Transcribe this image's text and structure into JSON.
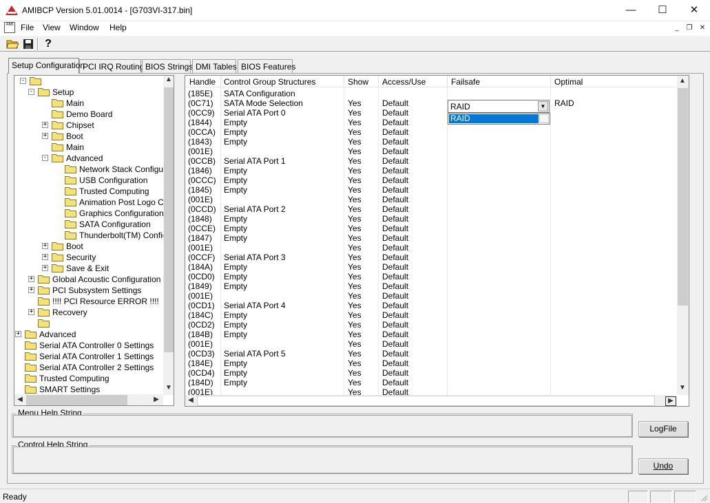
{
  "window": {
    "title": "AMIBCP Version 5.01.0014 - [G703VI-317.bin]",
    "minimize_glyph": "—",
    "maximize_glyph": "☐",
    "close_glyph": "✕"
  },
  "menu": {
    "mdi_icon_text": "AMI",
    "items": [
      "File",
      "View",
      "Window",
      "Help"
    ],
    "mdi_minimize": "_",
    "mdi_restore": "❐",
    "mdi_close": "✕"
  },
  "toolbar": {
    "buttons": [
      "open-folder-icon",
      "save-icon",
      "help-icon"
    ],
    "help_glyph": "?"
  },
  "tabs": [
    "Setup Configuration",
    "PCI IRQ Routing",
    "BIOS Strings",
    "DMI Tables",
    "BIOS Features"
  ],
  "tree": {
    "items": [
      {
        "label": "",
        "expander": "-"
      },
      {
        "label": "Setup",
        "expander": "-"
      },
      {
        "label": "Main",
        "expander": ""
      },
      {
        "label": "Demo Board",
        "expander": ""
      },
      {
        "label": "Chipset",
        "expander": "+"
      },
      {
        "label": "Boot",
        "expander": "+"
      },
      {
        "label": "Main",
        "expander": ""
      },
      {
        "label": "Advanced",
        "expander": "-"
      },
      {
        "label": "Network Stack Configura",
        "expander": ""
      },
      {
        "label": "USB Configuration",
        "expander": ""
      },
      {
        "label": "Trusted Computing",
        "expander": ""
      },
      {
        "label": "Animation Post Logo Con",
        "expander": ""
      },
      {
        "label": "Graphics Configuration",
        "expander": ""
      },
      {
        "label": "SATA Configuration",
        "expander": ""
      },
      {
        "label": "Thunderbolt(TM) Configu",
        "expander": ""
      },
      {
        "label": "Boot",
        "expander": "+"
      },
      {
        "label": "Security",
        "expander": "+"
      },
      {
        "label": "Save & Exit",
        "expander": "+"
      },
      {
        "label": "Global Acoustic Configuration",
        "expander": "+"
      },
      {
        "label": "PCI Subsystem Settings",
        "expander": "+"
      },
      {
        "label": "!!!! PCI Resource ERROR !!!!",
        "expander": ""
      },
      {
        "label": "Recovery",
        "expander": "+"
      },
      {
        "label": "",
        "expander": ""
      },
      {
        "label": "Advanced",
        "expander": "+"
      },
      {
        "label": "Serial ATA Controller 0 Settings",
        "expander": ""
      },
      {
        "label": "Serial ATA Controller 1 Settings",
        "expander": ""
      },
      {
        "label": "Serial ATA Controller 2 Settings",
        "expander": ""
      },
      {
        "label": "Trusted Computing",
        "expander": ""
      },
      {
        "label": "SMART Settings",
        "expander": ""
      }
    ]
  },
  "grid": {
    "columns": [
      "Handle",
      "Control Group Structures",
      "Show",
      "Access/Use",
      "Failsafe",
      "Optimal"
    ],
    "rows": [
      [
        "(185E)",
        "SATA Configuration",
        "",
        "",
        "",
        ""
      ],
      [
        "(0C71)",
        "SATA Mode Selection",
        "Yes",
        "Default",
        "",
        "RAID"
      ],
      [
        "(0CC9)",
        "Serial ATA Port 0",
        "Yes",
        "Default",
        "",
        ""
      ],
      [
        "(1844)",
        "Empty",
        "Yes",
        "Default",
        "",
        ""
      ],
      [
        "(0CCA)",
        "Empty",
        "Yes",
        "Default",
        "",
        ""
      ],
      [
        "(1843)",
        "Empty",
        "Yes",
        "Default",
        "",
        ""
      ],
      [
        "(001E)",
        "",
        "Yes",
        "Default",
        "",
        ""
      ],
      [
        "(0CCB)",
        "Serial ATA Port 1",
        "Yes",
        "Default",
        "",
        ""
      ],
      [
        "(1846)",
        "Empty",
        "Yes",
        "Default",
        "",
        ""
      ],
      [
        "(0CCC)",
        "Empty",
        "Yes",
        "Default",
        "",
        ""
      ],
      [
        "(1845)",
        "Empty",
        "Yes",
        "Default",
        "",
        ""
      ],
      [
        "(001E)",
        "",
        "Yes",
        "Default",
        "",
        ""
      ],
      [
        "(0CCD)",
        "Serial ATA Port 2",
        "Yes",
        "Default",
        "",
        ""
      ],
      [
        "(1848)",
        "Empty",
        "Yes",
        "Default",
        "",
        ""
      ],
      [
        "(0CCE)",
        "Empty",
        "Yes",
        "Default",
        "",
        ""
      ],
      [
        "(1847)",
        "Empty",
        "Yes",
        "Default",
        "",
        ""
      ],
      [
        "(001E)",
        "",
        "Yes",
        "Default",
        "",
        ""
      ],
      [
        "(0CCF)",
        "Serial ATA Port 3",
        "Yes",
        "Default",
        "",
        ""
      ],
      [
        "(184A)",
        "Empty",
        "Yes",
        "Default",
        "",
        ""
      ],
      [
        "(0CD0)",
        "Empty",
        "Yes",
        "Default",
        "",
        ""
      ],
      [
        "(1849)",
        "Empty",
        "Yes",
        "Default",
        "",
        ""
      ],
      [
        "(001E)",
        "",
        "Yes",
        "Default",
        "",
        ""
      ],
      [
        "(0CD1)",
        "Serial ATA Port 4",
        "Yes",
        "Default",
        "",
        ""
      ],
      [
        "(184C)",
        "Empty",
        "Yes",
        "Default",
        "",
        ""
      ],
      [
        "(0CD2)",
        "Empty",
        "Yes",
        "Default",
        "",
        ""
      ],
      [
        "(184B)",
        "Empty",
        "Yes",
        "Default",
        "",
        ""
      ],
      [
        "(001E)",
        "",
        "Yes",
        "Default",
        "",
        ""
      ],
      [
        "(0CD3)",
        "Serial ATA Port 5",
        "Yes",
        "Default",
        "",
        ""
      ],
      [
        "(184E)",
        "Empty",
        "Yes",
        "Default",
        "",
        ""
      ],
      [
        "(0CD4)",
        "Empty",
        "Yes",
        "Default",
        "",
        ""
      ],
      [
        "(184D)",
        "Empty",
        "Yes",
        "Default",
        "",
        ""
      ],
      [
        "(001E)",
        "",
        "Yes",
        "Default",
        "",
        ""
      ]
    ],
    "failsafe_combo": {
      "value": "RAID",
      "options": [
        "RAID"
      ],
      "arrow": "▼"
    }
  },
  "help": {
    "menu_label": "Menu Help String",
    "control_label": "Control Help String",
    "logfile_button": "LogFile",
    "undo_button": "Undo"
  },
  "status": {
    "text": "Ready"
  },
  "scroll_glyphs": {
    "up": "▲",
    "down": "▼",
    "left": "◀",
    "right": "▶"
  },
  "colors": {
    "selection": "#0078d7",
    "window_bg": "#f0f0f0"
  }
}
